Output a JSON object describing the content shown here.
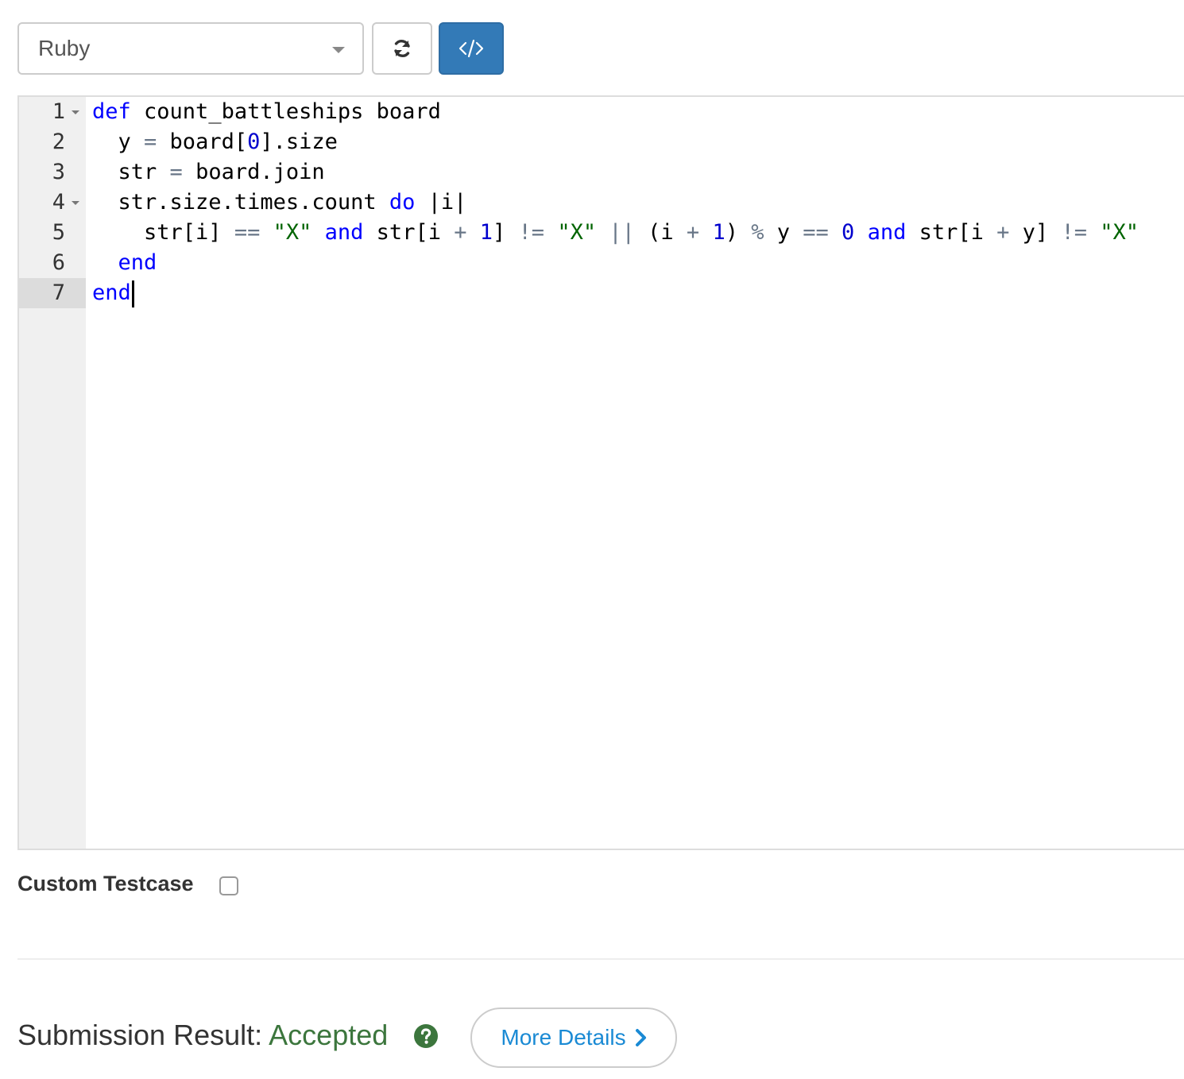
{
  "toolbar": {
    "language": "Ruby",
    "reset_icon": "refresh-icon",
    "code_icon": "code-brackets-icon",
    "accent_color": "#337ab7"
  },
  "editor": {
    "line_numbers": [
      "1",
      "2",
      "3",
      "4",
      "5",
      "6",
      "7"
    ],
    "active_line": 7,
    "lines": [
      "def count_battleships board",
      "  y = board[0].size",
      "  str = board.join",
      "  str.size.times.count do |i|",
      "    str[i] == \"X\" and str[i + 1] != \"X\" || (i + 1) % y == 0 and str[i + y] != \"X\"",
      "  end",
      "end"
    ]
  },
  "custom_testcase": {
    "label": "Custom Testcase",
    "checked": false
  },
  "result": {
    "label": "Submission Result: ",
    "status": "Accepted",
    "status_color": "#3c763d",
    "help_icon": "question-circle-icon",
    "more_details_label": "More Details",
    "more_details_icon": "chevron-right-icon"
  }
}
